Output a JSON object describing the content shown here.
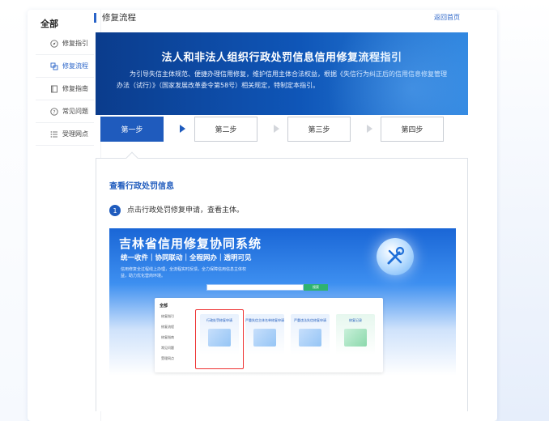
{
  "sidebar": {
    "title": "全部",
    "items": [
      {
        "label": "修复指引",
        "icon": "compass-icon",
        "active": false
      },
      {
        "label": "修复流程",
        "icon": "flow-icon",
        "active": true
      },
      {
        "label": "修复指南",
        "icon": "book-icon",
        "active": false
      },
      {
        "label": "常见问题",
        "icon": "question-icon",
        "active": false
      },
      {
        "label": "受理网点",
        "icon": "list-icon",
        "active": false
      }
    ]
  },
  "header": {
    "title": "修复流程",
    "back_label": "返回首页"
  },
  "banner": {
    "title": "法人和非法人组织行政处罚信息信用修复流程指引",
    "description": "为引导失信主体规范、便捷办理信用修复，维护信用主体合法权益，根据《失信行为纠正后的信用信息修复管理办法（试行）》（国家发展改革委令第58号）相关规定，特制定本指引。"
  },
  "steps": [
    {
      "label": "第一步",
      "active": true
    },
    {
      "label": "第二步",
      "active": false
    },
    {
      "label": "第三步",
      "active": false
    },
    {
      "label": "第四步",
      "active": false
    }
  ],
  "content": {
    "section_title": "查看行政处罚信息",
    "instruction_number": "1",
    "instruction_text": "点击行政处罚修复申请，查看主体。"
  },
  "screenshot": {
    "title": "吉林省信用修复协同系统",
    "subtitle": "统一收件｜协同联动｜全程网办｜透明可见",
    "description": "信用修复全过程线上办理，全流程实时反馈，全力保障信用信息主体权益，助力优化营商环境。",
    "search_btn": "搜索",
    "all_label": "全部",
    "mini_items": [
      "修复指引",
      "修复流程",
      "修复指南",
      "常见问题",
      "受理网点"
    ],
    "tiles": [
      "行政处罚修复申请",
      "严重失信主体名单修复申请",
      "严重违法失信修复申请",
      "修复记录"
    ]
  },
  "colors": {
    "accent": "#1f5bbd",
    "highlight": "#e33333"
  }
}
